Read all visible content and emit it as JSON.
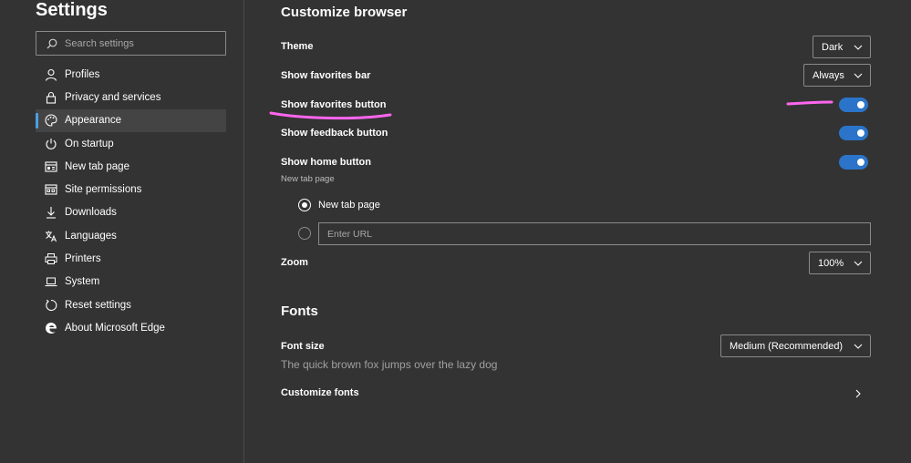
{
  "sidebar": {
    "title": "Settings",
    "search": {
      "placeholder": "Search settings"
    },
    "items": [
      {
        "label": "Profiles",
        "icon": "profile-icon"
      },
      {
        "label": "Privacy and services",
        "icon": "lock-icon"
      },
      {
        "label": "Appearance",
        "icon": "palette-icon",
        "active": true
      },
      {
        "label": "On startup",
        "icon": "power-icon"
      },
      {
        "label": "New tab page",
        "icon": "new-tab-icon"
      },
      {
        "label": "Site permissions",
        "icon": "site-permissions-icon"
      },
      {
        "label": "Downloads",
        "icon": "download-icon"
      },
      {
        "label": "Languages",
        "icon": "languages-icon"
      },
      {
        "label": "Printers",
        "icon": "printer-icon"
      },
      {
        "label": "System",
        "icon": "laptop-icon"
      },
      {
        "label": "Reset settings",
        "icon": "reset-icon"
      },
      {
        "label": "About Microsoft Edge",
        "icon": "edge-logo-icon"
      }
    ]
  },
  "main": {
    "customize": {
      "title": "Customize browser",
      "theme": {
        "label": "Theme",
        "value": "Dark"
      },
      "favorites_bar": {
        "label": "Show favorites bar",
        "value": "Always"
      },
      "favorites_button": {
        "label": "Show favorites button",
        "on": true
      },
      "feedback_button": {
        "label": "Show feedback button",
        "on": true
      },
      "home_button": {
        "label": "Show home button",
        "on": true,
        "sublabel": "New tab page",
        "option_new_tab": "New tab page",
        "url_placeholder": "Enter URL"
      },
      "zoom": {
        "label": "Zoom",
        "value": "100%"
      }
    },
    "fonts": {
      "title": "Fonts",
      "font_size": {
        "label": "Font size",
        "value": "Medium (Recommended)"
      },
      "preview": "The quick brown fox jumps over the lazy dog",
      "customize_fonts": {
        "label": "Customize fonts"
      }
    }
  },
  "colors": {
    "background": "#333333",
    "toggle_on": "#2b74c9",
    "active_indicator": "#4aa0e6",
    "annotation": "#ff66ee"
  }
}
